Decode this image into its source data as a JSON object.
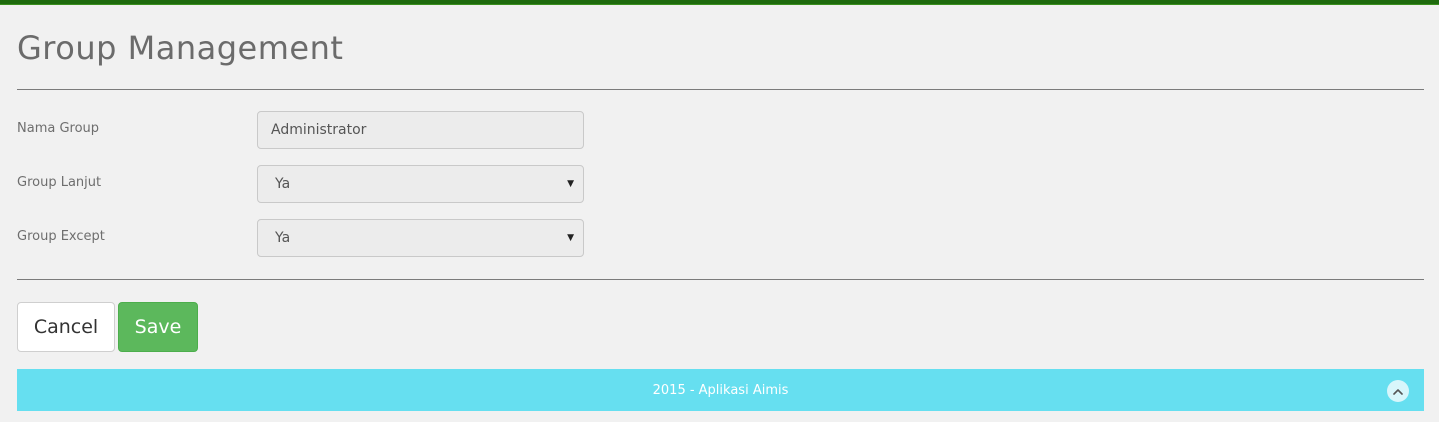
{
  "page": {
    "title": "Group Management"
  },
  "form": {
    "nama_group": {
      "label": "Nama Group",
      "value": "Administrator"
    },
    "group_lanjut": {
      "label": "Group Lanjut",
      "selected": "Ya"
    },
    "group_except": {
      "label": "Group Except",
      "selected": "Ya"
    }
  },
  "actions": {
    "cancel_label": "Cancel",
    "save_label": "Save"
  },
  "footer": {
    "text": "2015 - Aplikasi Aimis"
  },
  "colors": {
    "top_strip": "#1f6b0e",
    "save_button": "#5cb85c",
    "footer_bg": "#66dff0"
  },
  "icons": {
    "select_caret": "chevron-down-icon",
    "scroll_top": "chevron-up-icon"
  }
}
